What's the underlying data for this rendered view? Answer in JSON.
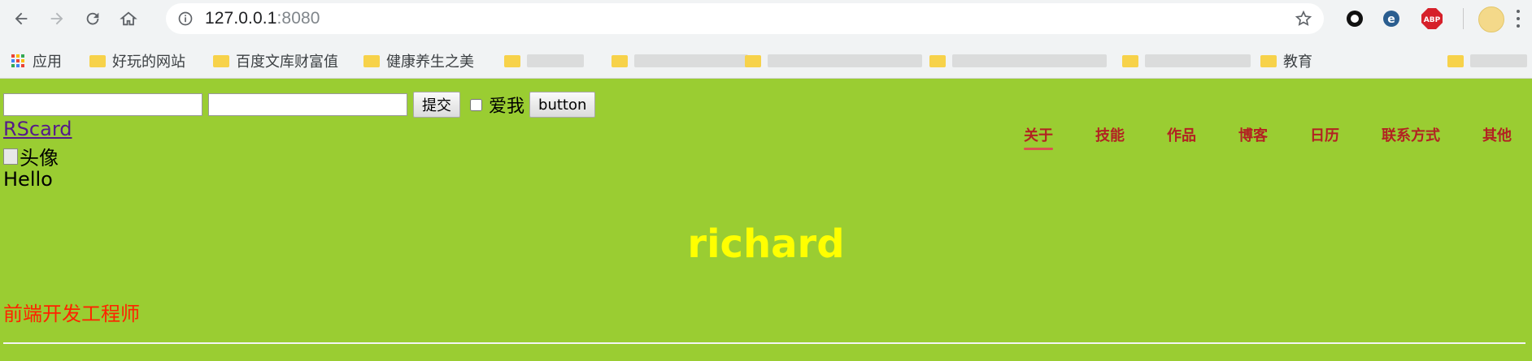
{
  "browser": {
    "url_host": "127.0.0.1",
    "url_port": ":8080",
    "extensions": [
      "record-icon",
      "e-icon",
      "abp-icon"
    ],
    "abp_label": "ABP"
  },
  "bookmarks": {
    "apps_label": "应用",
    "items": [
      {
        "label": "好玩的网站"
      },
      {
        "label": "百度文库财富值"
      },
      {
        "label": "健康养生之美"
      },
      {
        "label": "教育"
      }
    ]
  },
  "form": {
    "submit_label": "提交",
    "checkbox_label": "爱我",
    "button_label": "button"
  },
  "site": {
    "brand": "RScard",
    "avatar_alt": "头像",
    "hello": "Hello",
    "name": "richard",
    "job_title": "前端开发工程师",
    "nav": [
      {
        "label": "关于",
        "active": true
      },
      {
        "label": "技能"
      },
      {
        "label": "作品"
      },
      {
        "label": "博客"
      },
      {
        "label": "日历"
      },
      {
        "label": "联系方式"
      },
      {
        "label": "其他"
      }
    ]
  },
  "colors": {
    "background": "#9acd32",
    "name": "#ffff00",
    "nav": "#b22222",
    "job_title": "#ff2200"
  }
}
